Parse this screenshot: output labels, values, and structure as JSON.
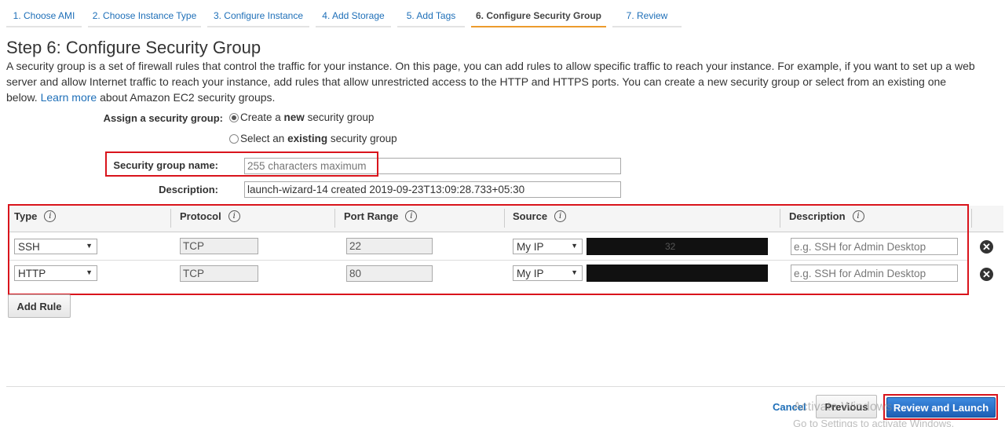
{
  "wizard": {
    "tabs": [
      {
        "label": "1. Choose AMI"
      },
      {
        "label": "2. Choose Instance Type"
      },
      {
        "label": "3. Configure Instance"
      },
      {
        "label": "4. Add Storage"
      },
      {
        "label": "5. Add Tags"
      },
      {
        "label": "6. Configure Security Group"
      },
      {
        "label": "7. Review"
      }
    ],
    "active_index": 5
  },
  "page": {
    "title": "Step 6: Configure Security Group",
    "intro_text": "A security group is a set of firewall rules that control the traffic for your instance. On this page, you can add rules to allow specific traffic to reach your instance. For example, if you want to set up a web server and allow Internet traffic to reach your instance, add rules that allow unrestricted access to the HTTP and HTTPS ports. You can create a new security group or select from an existing one below. ",
    "learn_more": "Learn more",
    "intro_suffix": " about Amazon EC2 security groups."
  },
  "form": {
    "assign_label": "Assign a security group:",
    "option_create": {
      "prefix": "Create a ",
      "bold": "new",
      "suffix": " security group",
      "checked": true
    },
    "option_existing": {
      "prefix": "Select an ",
      "bold": "existing",
      "suffix": " security group",
      "checked": false
    },
    "name_label": "Security group name:",
    "name_placeholder": "255 characters maximum",
    "name_value": "",
    "description_label": "Description:",
    "description_value": "launch-wizard-14 created 2019-09-23T13:09:28.733+05:30"
  },
  "rules": {
    "headers": [
      "Type",
      "Protocol",
      "Port Range",
      "Source",
      "Description"
    ],
    "info_glyph": "i",
    "rows": [
      {
        "type": "SSH",
        "protocol": "TCP",
        "port": "22",
        "source": "My IP",
        "source_ip_redacted": "32",
        "description_placeholder": "e.g. SSH for Admin Desktop"
      },
      {
        "type": "HTTP",
        "protocol": "TCP",
        "port": "80",
        "source": "My IP",
        "source_ip_redacted": "",
        "description_placeholder": "e.g. SSH for Admin Desktop"
      }
    ],
    "add_rule_label": "Add Rule",
    "remove_glyph": "✕"
  },
  "footer": {
    "cancel_label": "Cancel",
    "previous_label": "Previous",
    "review_launch_label": "Review and Launch"
  },
  "watermark": {
    "line1": "Activate Windows",
    "line2": "Go to Settings to activate Windows."
  },
  "colors": {
    "link": "#1e6fb8",
    "highlight_box": "#d9141c",
    "active_tab_underline": "#ec9b2d",
    "primary_button": "#1d5fb4"
  }
}
